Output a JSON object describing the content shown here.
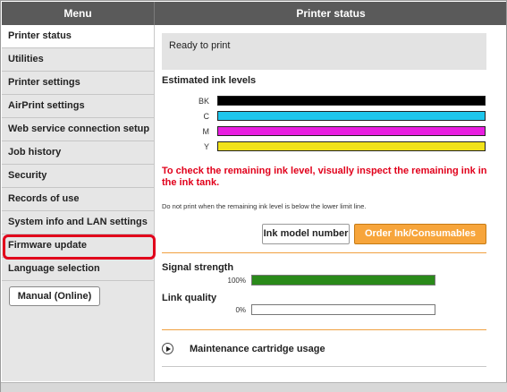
{
  "header": {
    "menu_label": "Menu",
    "status_title": "Printer status"
  },
  "sidebar": {
    "items": [
      {
        "label": "Printer status"
      },
      {
        "label": "Utilities"
      },
      {
        "label": "Printer settings"
      },
      {
        "label": "AirPrint settings"
      },
      {
        "label": "Web service connection setup"
      },
      {
        "label": "Job history"
      },
      {
        "label": "Security"
      },
      {
        "label": "Records of use"
      },
      {
        "label": "System info and LAN settings"
      },
      {
        "label": "Firmware update"
      },
      {
        "label": "Language selection"
      }
    ],
    "manual_button": "Manual (Online)"
  },
  "main": {
    "status_text": "Ready to print",
    "ink_title": "Estimated ink levels",
    "inks": [
      {
        "name": "BK",
        "color": "#000000"
      },
      {
        "name": "C",
        "color": "#1ec6ec"
      },
      {
        "name": "M",
        "color": "#e81ee0"
      },
      {
        "name": "Y",
        "color": "#f1e21a"
      }
    ],
    "warning": "To check the remaining ink level, visually inspect the remaining ink in the ink tank.",
    "note": "Do not print when the remaining ink level is below the lower limit line.",
    "ink_model_button": "Ink model number",
    "order_button": "Order Ink/Consumables Now",
    "signal_title": "Signal strength",
    "signal_pct": "100%",
    "signal_level": 1.0,
    "link_title": "Link quality",
    "link_pct": "0%",
    "link_level": 0.0,
    "maintenance_label": "Maintenance cartridge usage",
    "maintenance_icon": "play-circle-icon"
  }
}
